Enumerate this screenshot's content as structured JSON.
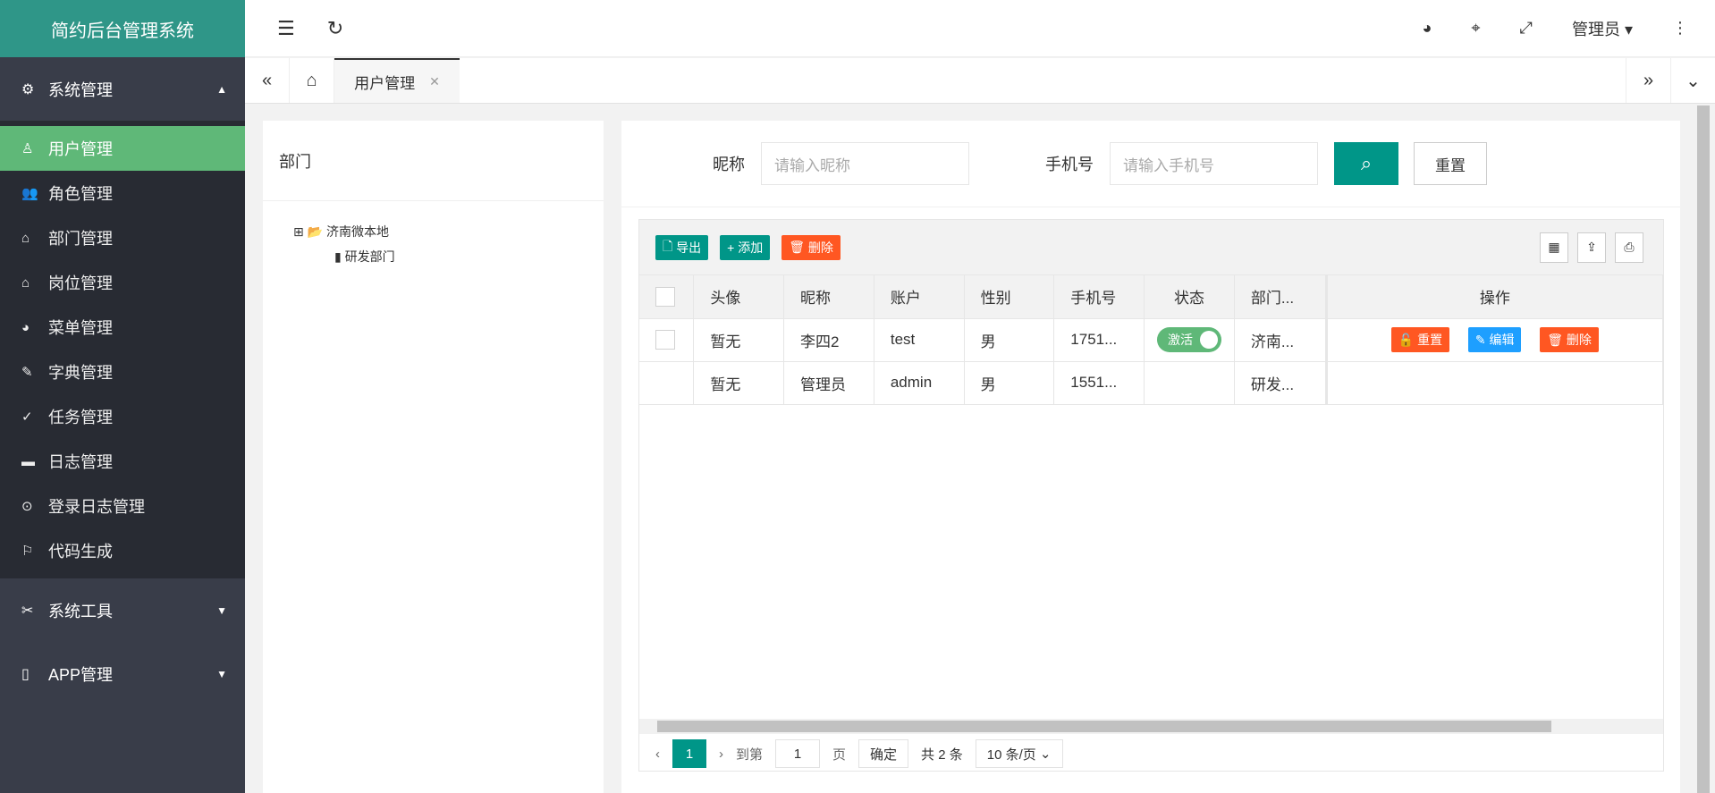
{
  "app_title": "简约后台管理系统",
  "sidebar": {
    "group1": "系统管理",
    "items": [
      {
        "label": "用户管理",
        "icon": "user-icon"
      },
      {
        "label": "角色管理",
        "icon": "users-icon"
      },
      {
        "label": "部门管理",
        "icon": "home-icon"
      },
      {
        "label": "岗位管理",
        "icon": "home-icon"
      },
      {
        "label": "菜单管理",
        "icon": "palette-icon"
      },
      {
        "label": "字典管理",
        "icon": "pencil-icon"
      },
      {
        "label": "任务管理",
        "icon": "check-circle-icon"
      },
      {
        "label": "日志管理",
        "icon": "sign-icon"
      },
      {
        "label": "登录日志管理",
        "icon": "location-icon"
      },
      {
        "label": "代码生成",
        "icon": "flag-icon"
      }
    ],
    "group2": "系统工具",
    "group3": "APP管理"
  },
  "header": {
    "user": "管理员"
  },
  "tabs": {
    "current": "用户管理"
  },
  "dept": {
    "title": "部门",
    "root": "济南微本地",
    "child": "研发部门"
  },
  "search": {
    "nickname_label": "昵称",
    "nickname_placeholder": "请输入昵称",
    "phone_label": "手机号",
    "phone_placeholder": "请输入手机号",
    "reset": "重置"
  },
  "toolbar": {
    "export": "导出",
    "add": "添加",
    "delete": "删除"
  },
  "table": {
    "headers": [
      "头像",
      "昵称",
      "账户",
      "性别",
      "手机号",
      "状态",
      "部门...",
      "操作"
    ],
    "rows": [
      {
        "avatar": "暂无",
        "nickname": "李四2",
        "account": "test",
        "gender": "男",
        "phone": "1751...",
        "status": "激活",
        "dept": "济南..."
      },
      {
        "avatar": "暂无",
        "nickname": "管理员",
        "account": "admin",
        "gender": "男",
        "phone": "1551...",
        "status": "",
        "dept": "研发..."
      }
    ],
    "actions": {
      "reset": "重置",
      "edit": "编辑",
      "delete": "删除"
    }
  },
  "pagination": {
    "page": "1",
    "goto": "到第",
    "goto_value": "1",
    "page_unit": "页",
    "confirm": "确定",
    "total": "共 2 条",
    "per_page": "10 条/页"
  }
}
